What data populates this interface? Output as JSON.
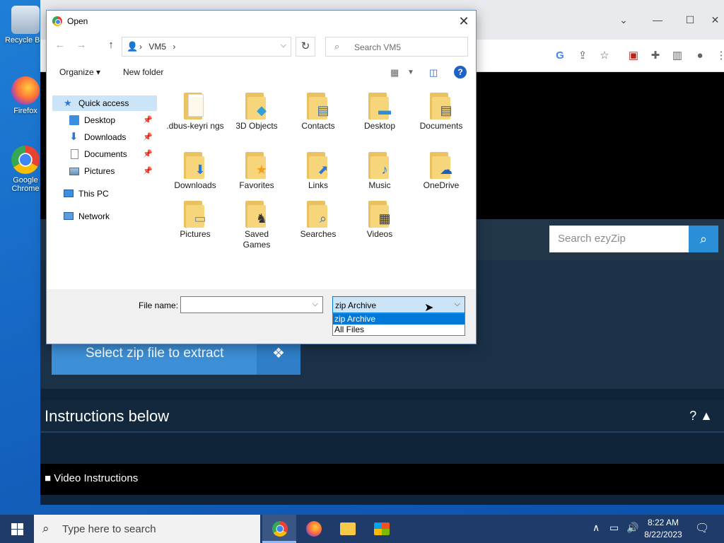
{
  "desktop": {
    "icons": [
      {
        "label": "Recycle Bin"
      },
      {
        "label": "Firefox"
      },
      {
        "label": "Google Chrome"
      }
    ]
  },
  "browser": {
    "search_placeholder": "Search ezyZip",
    "select_zip_label": "Select zip file to extract",
    "instructions_label": "Instructions below",
    "help_label": "? ▲",
    "video_label": "Video Instructions"
  },
  "dialog": {
    "title": "Open",
    "address": {
      "crumb": "VM5",
      "separator": "›"
    },
    "search_placeholder": "Search VM5",
    "organize_label": "Organize ▾",
    "new_folder_label": "New folder",
    "nav_pane": {
      "quick_access": "Quick access",
      "pinned": [
        "Desktop",
        "Downloads",
        "Documents",
        "Pictures"
      ],
      "this_pc": "This PC",
      "network": "Network"
    },
    "folders": [
      {
        "label": ".dbus-keyri ngs",
        "icon": "blank-file-icon"
      },
      {
        "label": "3D Objects",
        "icon": "cube-icon"
      },
      {
        "label": "Contacts",
        "icon": "contact-card-icon"
      },
      {
        "label": "Desktop",
        "icon": "monitor-icon"
      },
      {
        "label": "Documents",
        "icon": "document-icon"
      },
      {
        "label": "Downloads",
        "icon": "download-arrow-icon"
      },
      {
        "label": "Favorites",
        "icon": "star-icon"
      },
      {
        "label": "Links",
        "icon": "link-arrow-icon"
      },
      {
        "label": "Music",
        "icon": "music-note-icon"
      },
      {
        "label": "OneDrive",
        "icon": "cloud-icon"
      },
      {
        "label": "Pictures",
        "icon": "picture-icon"
      },
      {
        "label": "Saved Games",
        "icon": "chess-icon"
      },
      {
        "label": "Searches",
        "icon": "magnifier-icon"
      },
      {
        "label": "Videos",
        "icon": "film-icon"
      }
    ],
    "file_name_label": "File name:",
    "file_name_value": "",
    "file_type_selected": "zip Archive",
    "file_type_options": [
      "zip Archive",
      "All Files"
    ]
  },
  "taskbar": {
    "search_placeholder": "Type here to search",
    "time": "8:22 AM",
    "date": "8/22/2023"
  },
  "colors": {
    "dialog_accent": "#0078d7",
    "folder_yellow": "#f7d57a",
    "ezyzip_blue": "#2b8fd8",
    "taskbar": "#1f3b6a"
  }
}
